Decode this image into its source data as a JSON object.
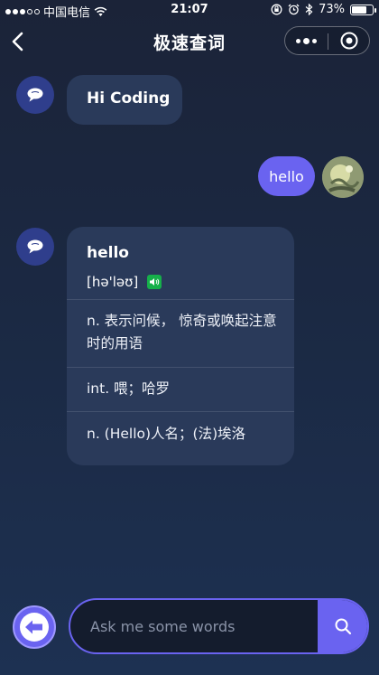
{
  "status_bar": {
    "carrier": "中国电信",
    "time": "21:07",
    "battery": "73%",
    "battery_level": 0.73
  },
  "nav": {
    "title": "极速查词"
  },
  "chat": {
    "greeting": "Hi Coding",
    "user_query": "hello",
    "result": {
      "word": "hello",
      "phonetic": "[hə'ləʊ]",
      "definitions": [
        "n. 表示问候， 惊奇或唤起注意时的用语",
        "int. 喂；哈罗",
        "n. (Hello)人名；(法)埃洛"
      ]
    }
  },
  "search": {
    "placeholder": "Ask me some words",
    "value": ""
  },
  "colors": {
    "accent": "#6a63f0",
    "bubble": "#2a3a5a",
    "bot_avatar": "#2f3e8c",
    "sound_icon": "#16b04a"
  }
}
